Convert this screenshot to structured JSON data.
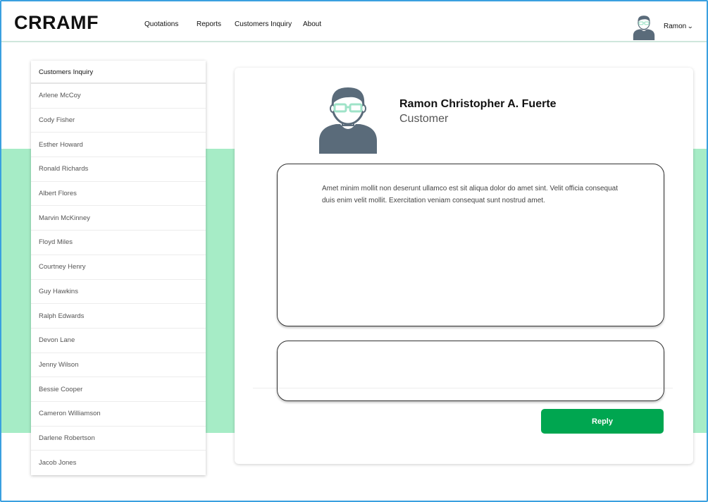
{
  "app": {
    "brand": "CRRAMF"
  },
  "nav": {
    "items": [
      {
        "label": "Quotations"
      },
      {
        "label": "Reports"
      },
      {
        "label": "Customers Inquiry"
      },
      {
        "label": "About"
      }
    ]
  },
  "user": {
    "name": "Ramon",
    "avatar_icon": "user-avatar-icon"
  },
  "sidebar": {
    "title": "Customers Inquiry",
    "items": [
      {
        "label": "Arlene McCoy"
      },
      {
        "label": "Cody Fisher"
      },
      {
        "label": "Esther Howard"
      },
      {
        "label": "Ronald Richards"
      },
      {
        "label": "Albert Flores"
      },
      {
        "label": "Marvin McKinney"
      },
      {
        "label": "Floyd Miles"
      },
      {
        "label": "Courtney Henry"
      },
      {
        "label": "Guy Hawkins"
      },
      {
        "label": "Ralph Edwards"
      },
      {
        "label": "Devon Lane"
      },
      {
        "label": "Jenny Wilson"
      },
      {
        "label": "Bessie Cooper"
      },
      {
        "label": "Cameron Williamson"
      },
      {
        "label": "Darlene Robertson"
      },
      {
        "label": "Jacob Jones"
      }
    ]
  },
  "profile": {
    "name": "Ramon Christopher A. Fuerte",
    "role": "Customer"
  },
  "message": {
    "text": "Amet minim mollit non deserunt ullamco est sit aliqua dolor do amet sint. Velit officia consequat duis enim velit mollit. Exercitation veniam consequat sunt nostrud amet."
  },
  "reply": {
    "value": "",
    "button_label": "Reply"
  },
  "colors": {
    "accent": "#00a650",
    "band": "#a6ecc6",
    "avatar": "#5a6b7a",
    "glasses": "#9fe3c8",
    "frame": "#3aa0e0"
  }
}
